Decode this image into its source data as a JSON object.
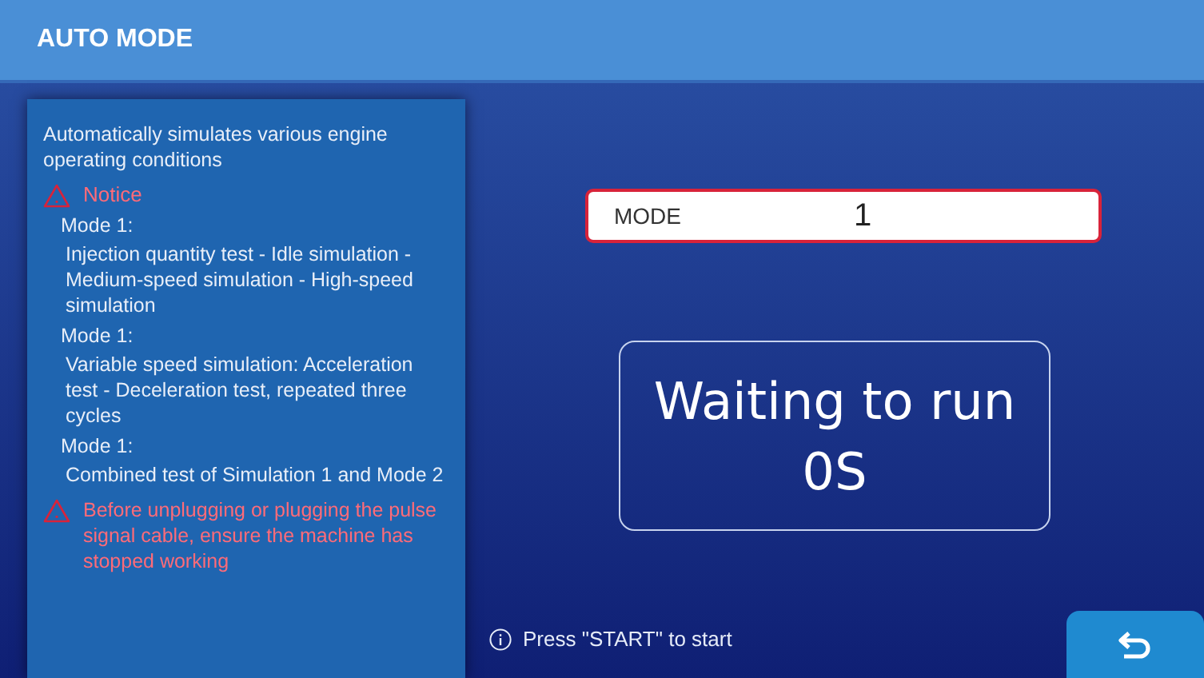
{
  "header": {
    "title": "AUTO MODE"
  },
  "panel": {
    "description": "Automatically simulates various engine operating conditions",
    "notice": {
      "title": "Notice"
    },
    "modes": [
      {
        "label": "Mode 1:",
        "text": "Injection quantity test - Idle simulation - Medium-speed simulation - High-speed simulation"
      },
      {
        "label": "Mode 1:",
        "text": "Variable speed simulation: Acceleration test - Deceleration test, repeated three cycles"
      },
      {
        "label": "Mode 1:",
        "text": "Combined test of Simulation 1 and Mode 2"
      }
    ],
    "warning": "Before unplugging or plugging the pulse signal cable, ensure the machine has stopped working"
  },
  "mode_field": {
    "label": "MODE",
    "value": "1"
  },
  "status": {
    "lines": [
      "Waiting to run",
      "0S"
    ]
  },
  "hint": "Press \"START\" to start"
}
